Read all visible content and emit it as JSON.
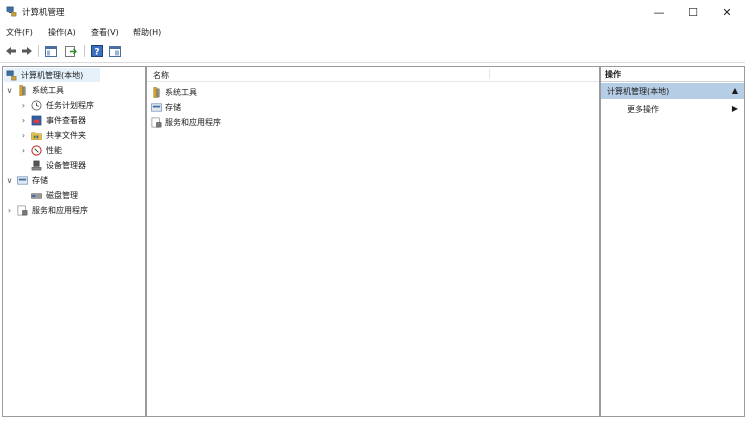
{
  "window": {
    "title": "计算机管理",
    "controls": {
      "minimize": "—",
      "maximize": "☐",
      "close": "✕"
    }
  },
  "menu": [
    "文件(F)",
    "操作(A)",
    "查看(V)",
    "帮助(H)"
  ],
  "toolbar": {
    "icons": [
      "back-arrow-icon",
      "forward-arrow-icon",
      "show-hide-tree-icon",
      "export-list-icon",
      "help-icon",
      "properties-icon"
    ]
  },
  "tree": {
    "root": "计算机管理(本地)",
    "system_tools": "系统工具",
    "task_scheduler": "任务计划程序",
    "event_viewer": "事件查看器",
    "shared_folders": "共享文件夹",
    "performance": "性能",
    "device_manager": "设备管理器",
    "storage": "存储",
    "disk_management": "磁盘管理",
    "services_apps": "服务和应用程序"
  },
  "list": {
    "column_name": "名称",
    "items": [
      "系统工具",
      "存储",
      "服务和应用程序"
    ]
  },
  "actions": {
    "header": "操作",
    "section": "计算机管理(本地)",
    "more": "更多操作"
  },
  "colors": {
    "selected_bg": "#e5f1fb",
    "action_section_bg": "#b6cde6"
  }
}
